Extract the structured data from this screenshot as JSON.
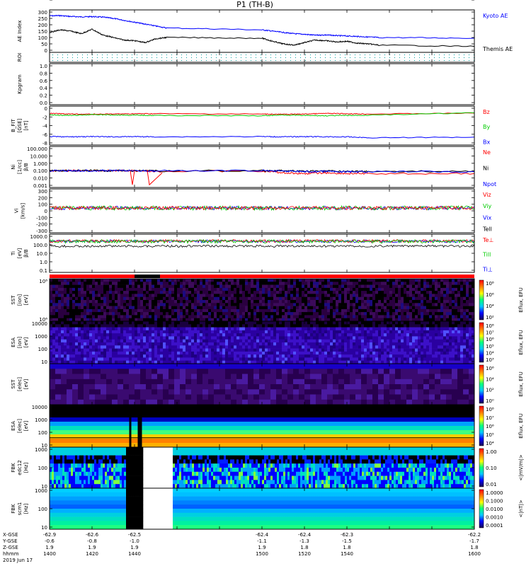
{
  "title": "P1 (TH-B)",
  "colors": {
    "black": "#000000",
    "blue": "#0000ff",
    "red": "#ff0000",
    "green": "#00cc00",
    "cyan": "#00b0b0"
  },
  "chart_data": [
    {
      "type": "line",
      "panel": "ae",
      "ylabel": "AE Index",
      "ylim": [
        0,
        300
      ],
      "yticks": [
        "300",
        "250",
        "200",
        "150",
        "100",
        "50",
        "0"
      ],
      "x": [
        1400,
        1405,
        1410,
        1415,
        1420,
        1425,
        1430,
        1435,
        1440,
        1445,
        1450,
        1455,
        1500,
        1505,
        1510,
        1515,
        1520,
        1525,
        1530,
        1535,
        1540,
        1545,
        1550,
        1555,
        1600
      ],
      "series": [
        {
          "name": "Kyoto AE",
          "color": "#0000ff",
          "values": [
            270,
            272,
            265,
            262,
            264,
            260,
            250,
            235,
            220,
            205,
            190,
            175,
            160,
            150,
            140,
            130,
            125,
            118,
            120,
            115,
            112,
            108,
            104,
            100,
            95
          ]
        },
        {
          "name": "Themis AE",
          "color": "#000000",
          "values": [
            140,
            160,
            150,
            130,
            165,
            120,
            100,
            80,
            75,
            60,
            90,
            100,
            95,
            70,
            50,
            40,
            60,
            80,
            75,
            65,
            70,
            55,
            50,
            40,
            30
          ]
        }
      ]
    },
    {
      "type": "scatter",
      "panel": "roi",
      "ylabel": "ROI"
    },
    {
      "type": "line",
      "panel": "kpgram",
      "ylabel": "Kpgram",
      "yticks": [
        "1.0",
        "0.8",
        "0.6",
        "0.4",
        "0.2",
        "0.0"
      ]
    },
    {
      "type": "line",
      "panel": "bfield",
      "ylabel": "B_FIT\n[GSE]\n[nT]",
      "ylim": [
        -10,
        2
      ],
      "yticks": [
        "0",
        "-2",
        "-4",
        "-6",
        "-8"
      ],
      "x": [
        1400,
        1410,
        1420,
        1430,
        1440,
        1450,
        1500,
        1510,
        1520,
        1530,
        1540,
        1550,
        1600
      ],
      "series": [
        {
          "name": "Bz",
          "color": "#ff0000",
          "values": [
            0.2,
            0.0,
            -0.1,
            0.0,
            0.1,
            0.1,
            0.0,
            -0.1,
            0.0,
            0.2,
            0.1,
            0.0,
            0.3
          ]
        },
        {
          "name": "By",
          "color": "#00cc00",
          "values": [
            -0.3,
            -0.5,
            -0.2,
            -0.3,
            -0.4,
            -0.5,
            -0.6,
            -0.3,
            -0.5,
            -0.6,
            -0.5,
            -0.4,
            0.4
          ]
        },
        {
          "name": "Bx",
          "color": "#0000ff",
          "values": [
            -7.8,
            -7.9,
            -7.8,
            -7.9,
            -7.8,
            -7.9,
            -7.8,
            -7.9,
            -7.8,
            -7.9,
            -7.9,
            -8.2,
            -8.0
          ]
        }
      ]
    },
    {
      "type": "line",
      "panel": "density",
      "ylabel": "Ni\n[1/cc]\nβ/B",
      "ylim": [
        0.001,
        100
      ],
      "yscale": "log",
      "yticks": [
        "100.000",
        "10.000",
        "1.000",
        "0.100",
        "0.010",
        "0.001"
      ],
      "x": [
        1400,
        1410,
        1420,
        1430,
        1440,
        1450,
        1500,
        1510,
        1520,
        1530,
        1540,
        1550,
        1600
      ],
      "series": [
        {
          "name": "Ne",
          "color": "#ff0000",
          "values": [
            0.1,
            0.1,
            0.1,
            0.1,
            0.1,
            0.08,
            0.09,
            0.05,
            0.04,
            0.05,
            0.04,
            0.04,
            0.04
          ]
        },
        {
          "name": "Ni",
          "color": "#000000",
          "values": [
            0.1,
            0.1,
            0.1,
            0.1,
            0.1,
            0.09,
            0.1,
            0.1,
            0.08,
            0.09,
            0.08,
            0.08,
            0.08
          ]
        },
        {
          "name": "Npot",
          "color": "#0000ff",
          "values": [
            0.1,
            0.1,
            0.1,
            0.1,
            0.1,
            0.09,
            0.1,
            0.09,
            0.07,
            0.08,
            0.07,
            0.07,
            0.07
          ]
        }
      ]
    },
    {
      "type": "line",
      "panel": "velocity",
      "ylabel": "Vi\n[km/s]",
      "ylim": [
        -400,
        300
      ],
      "yticks": [
        "300",
        "200",
        "100",
        "0",
        "-100",
        "-200",
        "-300"
      ],
      "series": [
        {
          "name": "Viz",
          "color": "#ff0000"
        },
        {
          "name": "Viy",
          "color": "#00cc00"
        },
        {
          "name": "Vix",
          "color": "#0000ff"
        },
        {
          "name": "Tell",
          "color": "#000000"
        }
      ]
    },
    {
      "type": "line",
      "panel": "temperature",
      "ylabel": "Ti\n[eV]\nβ/B",
      "ylim": [
        0.1,
        1000
      ],
      "yscale": "log",
      "yticks": [
        "1000.0",
        "100.0",
        "10.0",
        "1.0",
        "0.1"
      ],
      "series": [
        {
          "name": "Te⊥",
          "color": "#ff0000"
        },
        {
          "name": "Till",
          "color": "#00cc00"
        },
        {
          "name": "Ti⊥",
          "color": "#0000ff"
        }
      ]
    },
    {
      "type": "heatmap",
      "panel": "sst-ion",
      "ylabel": "SST\n[ion]\n[eV]",
      "yticks": [
        "10⁸",
        "10⁶"
      ],
      "colorbar": {
        "label": "Eflux, EFU",
        "ticks": [
          "10⁸",
          "10⁶",
          "10⁴",
          "10²"
        ]
      }
    },
    {
      "type": "heatmap",
      "panel": "esa-ion",
      "ylabel": "ESA\n[ion]\n[eV]",
      "yticks": [
        "10000",
        "1000",
        "100",
        "10"
      ],
      "colorbar": {
        "label": "Eflux, EFU",
        "ticks": [
          "10⁸",
          "10⁷",
          "10⁶",
          "10⁵",
          "10⁴",
          "10³"
        ]
      }
    },
    {
      "type": "heatmap",
      "panel": "sst-elec",
      "ylabel": "SST\n[elec]\n[eV]",
      "yticks": [
        "10⁵"
      ],
      "colorbar": {
        "label": "Eflux, EFU",
        "ticks": [
          "10⁶",
          "10⁴",
          "10²",
          "10⁰"
        ]
      }
    },
    {
      "type": "heatmap",
      "panel": "esa-elec",
      "ylabel": "ESA\n[elec]\n[eV]",
      "yticks": [
        "10000",
        "1000",
        "100",
        "10"
      ],
      "colorbar": {
        "label": "Eflux, EFU",
        "ticks": [
          "10⁸",
          "10⁷",
          "10⁶",
          "10⁵",
          "10⁴"
        ]
      }
    },
    {
      "type": "heatmap",
      "panel": "fbk-edc",
      "ylabel": "FBK\nedc12\n[Hz]",
      "yticks": [
        "1000",
        "100",
        "10"
      ],
      "colorbar": {
        "label": "<|mV/m|>",
        "ticks": [
          "1.00",
          "0.10",
          "0.01"
        ]
      }
    },
    {
      "type": "heatmap",
      "panel": "fbk-scm",
      "ylabel": "FBK\nscm1\n[Hz]",
      "yticks": [
        "1000",
        "100",
        "10"
      ],
      "colorbar": {
        "label": "<|nT|>",
        "ticks": [
          "1.0000",
          "0.1000",
          "0.0100",
          "0.0010",
          "0.0001"
        ]
      }
    }
  ],
  "time_axis": {
    "row_labels": [
      "X-GSE",
      "Y-GSE",
      "Z-GSE",
      "hhmm",
      "2019 Jun 17"
    ],
    "columns": [
      {
        "x": 1400,
        "vals": [
          "-62.9",
          "-0.6",
          "1.9",
          "1400"
        ]
      },
      {
        "x": 1420,
        "vals": [
          "-62.6",
          "-0.8",
          "1.9",
          "1420"
        ]
      },
      {
        "x": 1440,
        "vals": [
          "-62.5",
          "-1.0",
          "1.9",
          "1440"
        ]
      },
      {
        "x": 1500,
        "vals": [
          "-62.4",
          "-1.1",
          "1.9",
          "1500"
        ]
      },
      {
        "x": 1520,
        "vals": [
          "-62.4",
          "-1.3",
          "1.8",
          "1520"
        ]
      },
      {
        "x": 1540,
        "vals": [
          "-62.3",
          "-1.5",
          "1.8",
          "1540"
        ]
      },
      {
        "x": 1600,
        "vals": [
          "-62.2",
          "-1.7",
          "1.8",
          "1600"
        ]
      }
    ]
  }
}
